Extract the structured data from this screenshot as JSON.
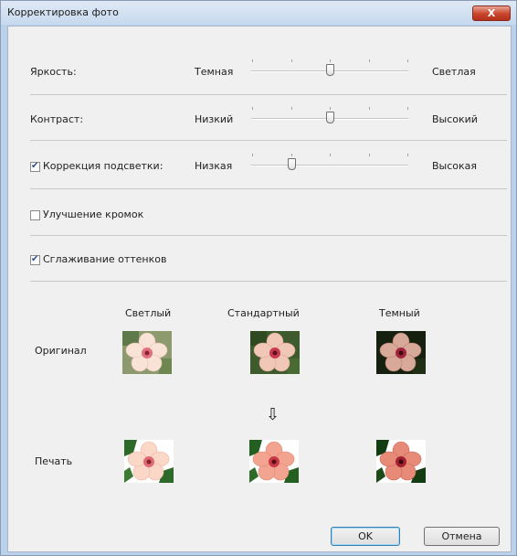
{
  "window": {
    "title": "Корректировка фото",
    "close_label": "X"
  },
  "adjustments": {
    "brightness": {
      "label": "Яркость:",
      "left": "Темная",
      "right": "Светлая",
      "level_fraction": 0.5
    },
    "contrast": {
      "label": "Контраст:",
      "left": "Низкий",
      "right": "Высокий",
      "level_fraction": 0.5
    },
    "backlight": {
      "label": "Коррекция подсветки:",
      "checked": true,
      "left": "Низкая",
      "right": "Высокая",
      "level_fraction": 0.25
    }
  },
  "options": {
    "edge_enhance": {
      "label": "Улучшение кромок",
      "checked": false
    },
    "smooth_tones": {
      "label": "Сглаживание оттенков",
      "checked": true
    }
  },
  "preview": {
    "columns": [
      "Светлый",
      "Стандартный",
      "Темный"
    ],
    "row_original": "Оригинал",
    "row_print": "Печать",
    "arrow_icon": "down-arrow-icon"
  },
  "buttons": {
    "ok": "OK",
    "cancel": "Отмена"
  },
  "colors": {
    "dialog_bg": "#f0f0f0",
    "frame": "#b9d1ea",
    "close": "#c8452b"
  }
}
